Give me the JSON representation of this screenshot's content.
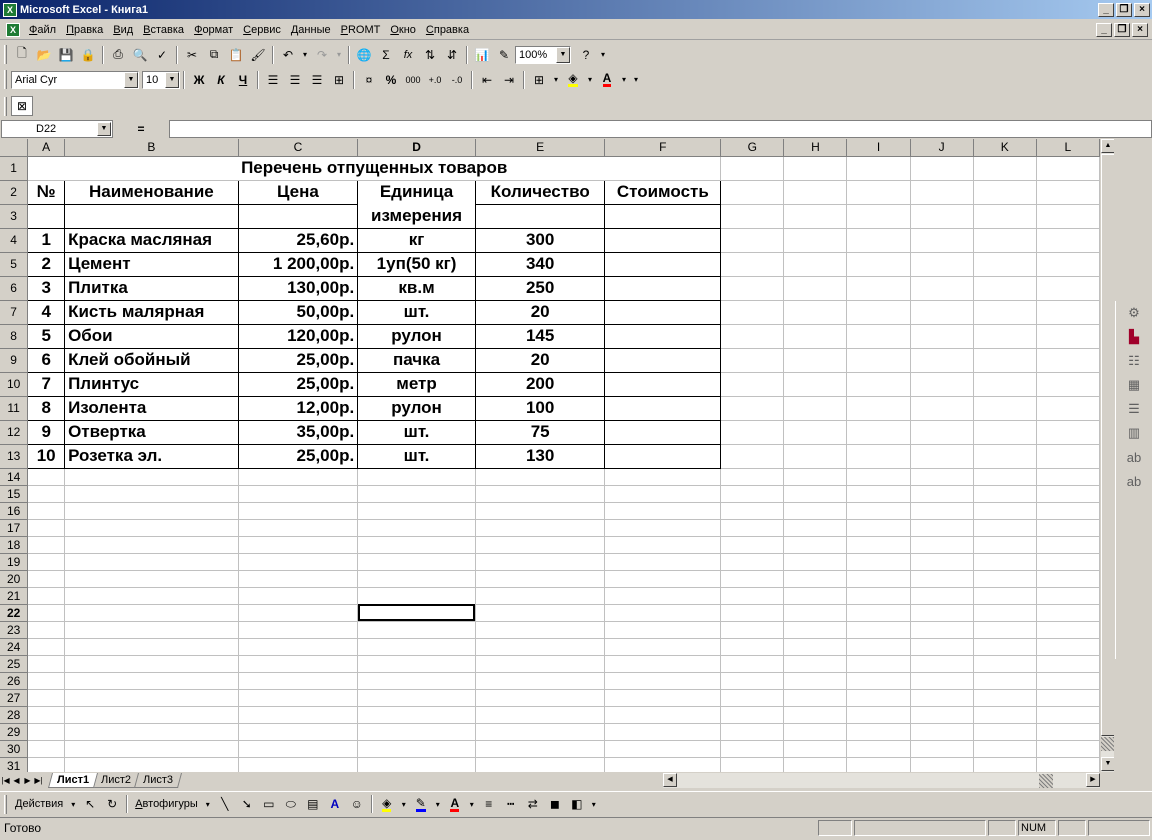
{
  "window": {
    "title": "Microsoft Excel - Книга1",
    "app_icon": "excel-icon",
    "buttons": [
      "_",
      "▫",
      "×"
    ]
  },
  "menu": {
    "items": [
      "Файл",
      "Правка",
      "Вид",
      "Вставка",
      "Формат",
      "Сервис",
      "Данные",
      "PROMT",
      "Окно",
      "Справка"
    ]
  },
  "format_toolbar": {
    "font": "Arial Cyr",
    "size": "10",
    "bold": "Ж",
    "italic": "К",
    "underline": "Ч",
    "percent": "%",
    "thousands": "000",
    "currency_colors": {
      "fill": "#ffff00",
      "font": "#ff0000"
    }
  },
  "standard_toolbar": {
    "zoom": "100%",
    "sum": "Σ",
    "function": "fx"
  },
  "formula_bar": {
    "name_box": "D22",
    "equals": "=",
    "value": ""
  },
  "columns": [
    "A",
    "B",
    "C",
    "D",
    "E",
    "F",
    "G",
    "H",
    "I",
    "J",
    "K",
    "L"
  ],
  "rows": [
    "1",
    "2",
    "3",
    "4",
    "5",
    "6",
    "7",
    "8",
    "9",
    "10",
    "11",
    "12",
    "13",
    "14",
    "15",
    "16",
    "17",
    "18",
    "19",
    "20",
    "21",
    "22",
    "23",
    "24",
    "25",
    "26",
    "27",
    "28",
    "29",
    "30",
    "31"
  ],
  "sheet": {
    "title": "Перечень отпущенных товаров",
    "headers": {
      "num": "№",
      "name": "Наименование",
      "price": "Цена",
      "unit": "Единица",
      "unit2": "измерения",
      "qty": "Количество",
      "cost": "Стоимость"
    },
    "items": [
      {
        "num": "1",
        "name": "Краска масляная",
        "price": "25,60р.",
        "unit": "кг",
        "qty": "300"
      },
      {
        "num": "2",
        "name": "Цемент",
        "price": "1 200,00р.",
        "unit": "1уп(50 кг)",
        "qty": "340"
      },
      {
        "num": "3",
        "name": "Плитка",
        "price": "130,00р.",
        "unit": "кв.м",
        "qty": "250"
      },
      {
        "num": "4",
        "name": "Кисть малярная",
        "price": "50,00р.",
        "unit": "шт.",
        "qty": "20"
      },
      {
        "num": "5",
        "name": "Обои",
        "price": "120,00р.",
        "unit": "рулон",
        "qty": "145"
      },
      {
        "num": "6",
        "name": "Клей обойный",
        "price": "25,00р.",
        "unit": "пачка",
        "qty": "20"
      },
      {
        "num": "7",
        "name": "Плинтус",
        "price": "25,00р.",
        "unit": "метр",
        "qty": "200"
      },
      {
        "num": "8",
        "name": "Изолента",
        "price": "12,00р.",
        "unit": "рулон",
        "qty": "100"
      },
      {
        "num": "9",
        "name": "Отвертка",
        "price": "35,00р.",
        "unit": "шт.",
        "qty": "75"
      },
      {
        "num": "10",
        "name": "Розетка эл.",
        "price": "25,00р.",
        "unit": "шт.",
        "qty": "130"
      }
    ]
  },
  "tabs": [
    "Лист1",
    "Лист2",
    "Лист3"
  ],
  "drawing": {
    "actions": "Действия",
    "autoshapes": "Автофигуры"
  },
  "status": {
    "text": "Готово",
    "num": "NUM"
  }
}
